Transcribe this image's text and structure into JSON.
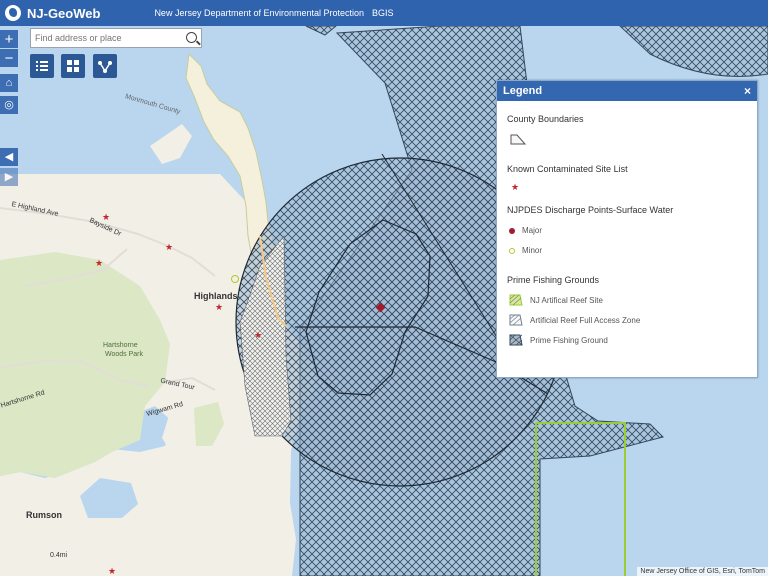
{
  "header": {
    "app_title": "NJ-GeoWeb",
    "agency": "New Jersey Department of Environmental Protection",
    "bgis": "BGIS"
  },
  "controls": {
    "zoom_in": "+",
    "zoom_out": "−",
    "search_placeholder": "Find address or place"
  },
  "legend": {
    "title": "Legend",
    "close": "×",
    "groups": [
      {
        "label": "County Boundaries"
      },
      {
        "label": "Known Contaminated Site List"
      },
      {
        "label": "NJPDES Discharge Points-Surface Water",
        "items": [
          "Major",
          "Minor"
        ]
      },
      {
        "label": "Prime Fishing Grounds",
        "items": [
          "NJ Artifical Reef Site",
          "Artificial Reef Full Access Zone",
          "Prime Fishing Ground"
        ]
      }
    ]
  },
  "map_labels": {
    "highlands": "Highlands",
    "hartshorne": "Hartshorne",
    "woods_park": "Woods Park",
    "rumson": "Rumson",
    "monmouth": "Monmouth County",
    "highland_ave": "E Highland Ave",
    "bayside": "Bayside Dr",
    "hartshorne_rd": "Hartshorne Rd",
    "grand_tour": "Grand Tour",
    "wigwam": "Wigwam Rd",
    "scale": "0.4mi"
  },
  "attribution": "New Jersey Office of GIS, Esri, TomTom",
  "colors": {
    "header": "#2f63ae",
    "water": "#b9d6ee",
    "land": "#f2efe7",
    "park": "#dbe7c5",
    "hatch": "#33475b",
    "reef_outline": "#9acd32",
    "site_marker": "#c1272d"
  }
}
